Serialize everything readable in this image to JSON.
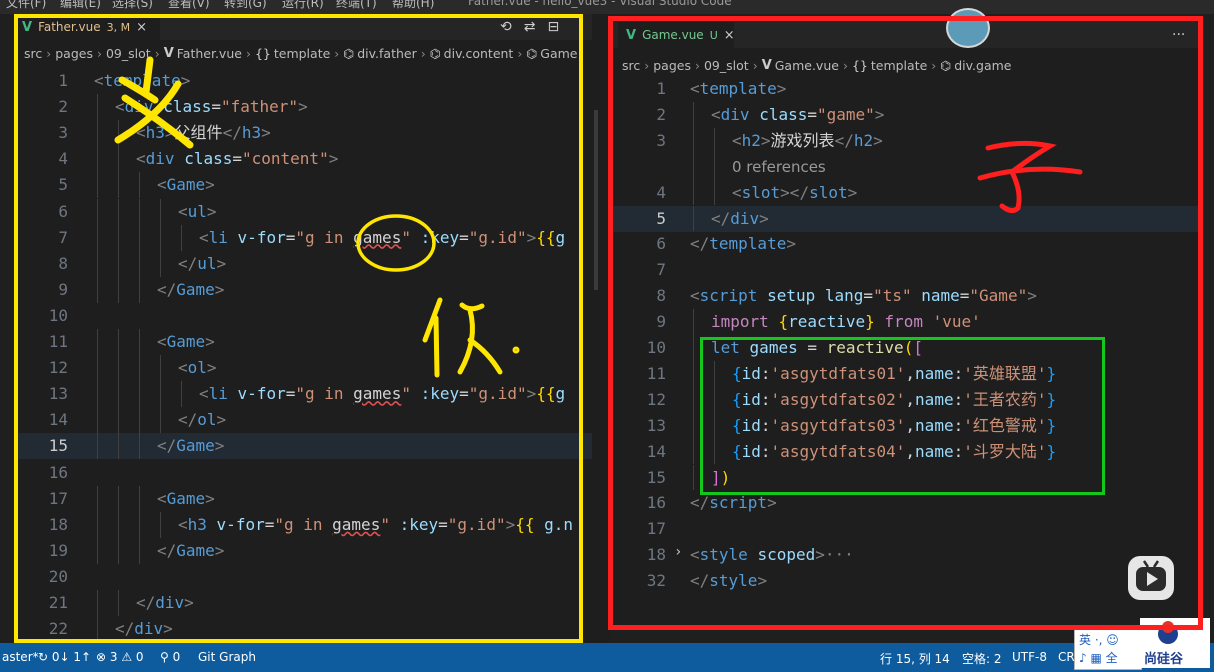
{
  "window": {
    "menu": [
      "文件(F)",
      "编辑(E)",
      "选择(S)",
      "查看(V)",
      "转到(G)",
      "运行(R)",
      "终端(T)",
      "帮助(H)"
    ],
    "title": "Father.vue - hello_vue3 - Visual Studio Code"
  },
  "left_editor": {
    "tab": {
      "name": "Father.vue",
      "status": "3, M",
      "close": "×"
    },
    "actions": [
      "⟲",
      "⇄",
      "⊟",
      "···"
    ],
    "breadcrumb": [
      {
        "label": "src",
        "icon": ""
      },
      {
        "label": "pages",
        "icon": ""
      },
      {
        "label": "09_slot",
        "icon": ""
      },
      {
        "label": "Father.vue",
        "icon": "vue-icon"
      },
      {
        "label": "template",
        "icon": "{}"
      },
      {
        "label": "div.father",
        "icon": "⌬"
      },
      {
        "label": "div.content",
        "icon": "⌬"
      },
      {
        "label": "Game",
        "icon": "⌬"
      }
    ],
    "current_line": "15",
    "lines": [
      {
        "n": "1",
        "indent": 0,
        "tokens": [
          [
            "<",
            "pun"
          ],
          [
            "template",
            "tag"
          ],
          [
            ">",
            "pun"
          ]
        ]
      },
      {
        "n": "2",
        "indent": 1,
        "tokens": [
          [
            "<",
            "pun"
          ],
          [
            "div",
            "tag"
          ],
          [
            " ",
            "def"
          ],
          [
            "class",
            "attr"
          ],
          [
            "=",
            "def"
          ],
          [
            "\"father\"",
            "str"
          ],
          [
            ">",
            "pun"
          ]
        ]
      },
      {
        "n": "3",
        "indent": 2,
        "tokens": [
          [
            "<",
            "pun"
          ],
          [
            "h3",
            "tag"
          ],
          [
            ">",
            "pun"
          ],
          [
            "父组件",
            "def"
          ],
          [
            "</",
            "pun"
          ],
          [
            "h3",
            "tag"
          ],
          [
            ">",
            "pun"
          ]
        ]
      },
      {
        "n": "4",
        "indent": 2,
        "tokens": [
          [
            "<",
            "pun"
          ],
          [
            "div",
            "tag"
          ],
          [
            " ",
            "def"
          ],
          [
            "class",
            "attr"
          ],
          [
            "=",
            "def"
          ],
          [
            "\"content\"",
            "str"
          ],
          [
            ">",
            "pun"
          ]
        ]
      },
      {
        "n": "5",
        "indent": 3,
        "tokens": [
          [
            "<",
            "pun"
          ],
          [
            "Game",
            "tag"
          ],
          [
            ">",
            "pun"
          ]
        ]
      },
      {
        "n": "6",
        "indent": 4,
        "tokens": [
          [
            "<",
            "pun"
          ],
          [
            "ul",
            "tag"
          ],
          [
            ">",
            "pun"
          ]
        ]
      },
      {
        "n": "7",
        "indent": 5,
        "tokens": [
          [
            "<",
            "pun"
          ],
          [
            "li",
            "tag"
          ],
          [
            " ",
            "def"
          ],
          [
            "v-for",
            "attr"
          ],
          [
            "=",
            "def"
          ],
          [
            "\"g in ",
            "str"
          ],
          [
            "games",
            "sq"
          ],
          [
            "\"",
            "str"
          ],
          [
            " ",
            "def"
          ],
          [
            ":key",
            "attr"
          ],
          [
            "=",
            "def"
          ],
          [
            "\"g.id\"",
            "str"
          ],
          [
            ">",
            "pun"
          ],
          [
            "{{",
            "br1"
          ],
          [
            "g",
            "var"
          ]
        ]
      },
      {
        "n": "8",
        "indent": 4,
        "tokens": [
          [
            "</",
            "pun"
          ],
          [
            "ul",
            "tag"
          ],
          [
            ">",
            "pun"
          ]
        ]
      },
      {
        "n": "9",
        "indent": 3,
        "tokens": [
          [
            "</",
            "pun"
          ],
          [
            "Game",
            "tag"
          ],
          [
            ">",
            "pun"
          ]
        ]
      },
      {
        "n": "10",
        "indent": 0,
        "tokens": []
      },
      {
        "n": "11",
        "indent": 3,
        "tokens": [
          [
            "<",
            "pun"
          ],
          [
            "Game",
            "tag"
          ],
          [
            ">",
            "pun"
          ]
        ]
      },
      {
        "n": "12",
        "indent": 4,
        "tokens": [
          [
            "<",
            "pun"
          ],
          [
            "ol",
            "tag"
          ],
          [
            ">",
            "pun"
          ]
        ]
      },
      {
        "n": "13",
        "indent": 5,
        "tokens": [
          [
            "<",
            "pun"
          ],
          [
            "li",
            "tag"
          ],
          [
            " ",
            "def"
          ],
          [
            "v-for",
            "attr"
          ],
          [
            "=",
            "def"
          ],
          [
            "\"g in ",
            "str"
          ],
          [
            "games",
            "sq"
          ],
          [
            "\"",
            "str"
          ],
          [
            " ",
            "def"
          ],
          [
            ":key",
            "attr"
          ],
          [
            "=",
            "def"
          ],
          [
            "\"g.id\"",
            "str"
          ],
          [
            ">",
            "pun"
          ],
          [
            "{{",
            "br1"
          ],
          [
            "g",
            "var"
          ]
        ]
      },
      {
        "n": "14",
        "indent": 4,
        "tokens": [
          [
            "</",
            "pun"
          ],
          [
            "ol",
            "tag"
          ],
          [
            ">",
            "pun"
          ]
        ]
      },
      {
        "n": "15",
        "indent": 3,
        "tokens": [
          [
            "</",
            "pun"
          ],
          [
            "Game",
            "tag"
          ],
          [
            ">",
            "pun"
          ]
        ]
      },
      {
        "n": "16",
        "indent": 0,
        "tokens": []
      },
      {
        "n": "17",
        "indent": 3,
        "tokens": [
          [
            "<",
            "pun"
          ],
          [
            "Game",
            "tag"
          ],
          [
            ">",
            "pun"
          ]
        ]
      },
      {
        "n": "18",
        "indent": 4,
        "tokens": [
          [
            "<",
            "pun"
          ],
          [
            "h3",
            "tag"
          ],
          [
            " ",
            "def"
          ],
          [
            "v-for",
            "attr"
          ],
          [
            "=",
            "def"
          ],
          [
            "\"g in ",
            "str"
          ],
          [
            "games",
            "sq"
          ],
          [
            "\"",
            "str"
          ],
          [
            " ",
            "def"
          ],
          [
            ":key",
            "attr"
          ],
          [
            "=",
            "def"
          ],
          [
            "\"g.id\"",
            "str"
          ],
          [
            ">",
            "pun"
          ],
          [
            "{{",
            "br1"
          ],
          [
            " g.n",
            "var"
          ]
        ]
      },
      {
        "n": "19",
        "indent": 3,
        "tokens": [
          [
            "</",
            "pun"
          ],
          [
            "Game",
            "tag"
          ],
          [
            ">",
            "pun"
          ]
        ]
      },
      {
        "n": "20",
        "indent": 0,
        "tokens": []
      },
      {
        "n": "21",
        "indent": 2,
        "tokens": [
          [
            "</",
            "pun"
          ],
          [
            "div",
            "tag"
          ],
          [
            ">",
            "pun"
          ]
        ]
      },
      {
        "n": "22",
        "indent": 1,
        "tokens": [
          [
            "</",
            "pun"
          ],
          [
            "div",
            "tag"
          ],
          [
            ">",
            "pun"
          ]
        ]
      }
    ]
  },
  "right_editor": {
    "tab": {
      "name": "Game.vue",
      "status": "U",
      "close": "×"
    },
    "actions": [
      "···"
    ],
    "breadcrumb": [
      {
        "label": "src",
        "icon": ""
      },
      {
        "label": "pages",
        "icon": ""
      },
      {
        "label": "09_slot",
        "icon": ""
      },
      {
        "label": "Game.vue",
        "icon": "vue-icon"
      },
      {
        "label": "template",
        "icon": "{}"
      },
      {
        "label": "div.game",
        "icon": "⌬"
      }
    ],
    "current_line": "5",
    "lines": [
      {
        "n": "1",
        "indent": 0,
        "tokens": [
          [
            "<",
            "pun"
          ],
          [
            "template",
            "tag"
          ],
          [
            ">",
            "pun"
          ]
        ]
      },
      {
        "n": "2",
        "indent": 1,
        "tokens": [
          [
            "<",
            "pun"
          ],
          [
            "div",
            "tag"
          ],
          [
            " ",
            "def"
          ],
          [
            "class",
            "attr"
          ],
          [
            "=",
            "def"
          ],
          [
            "\"game\"",
            "str"
          ],
          [
            ">",
            "pun"
          ]
        ]
      },
      {
        "n": "3",
        "indent": 2,
        "tokens": [
          [
            "<",
            "pun"
          ],
          [
            "h2",
            "tag"
          ],
          [
            ">",
            "pun"
          ],
          [
            "游戏列表",
            "def"
          ],
          [
            "</",
            "pun"
          ],
          [
            "h2",
            "tag"
          ],
          [
            ">",
            "pun"
          ]
        ]
      },
      {
        "n": "",
        "indent": 2,
        "tokens": [
          [
            "0 references",
            "lens"
          ]
        ]
      },
      {
        "n": "4",
        "indent": 2,
        "tokens": [
          [
            "<",
            "pun"
          ],
          [
            "slot",
            "tag"
          ],
          [
            "></",
            "pun"
          ],
          [
            "slot",
            "tag"
          ],
          [
            ">",
            "pun"
          ]
        ]
      },
      {
        "n": "5",
        "indent": 1,
        "tokens": [
          [
            "</",
            "pun"
          ],
          [
            "div",
            "tag"
          ],
          [
            ">",
            "pun"
          ]
        ]
      },
      {
        "n": "6",
        "indent": 0,
        "tokens": [
          [
            "</",
            "pun"
          ],
          [
            "template",
            "tag"
          ],
          [
            ">",
            "pun"
          ]
        ]
      },
      {
        "n": "7",
        "indent": 0,
        "tokens": []
      },
      {
        "n": "8",
        "indent": 0,
        "tokens": [
          [
            "<",
            "pun"
          ],
          [
            "script",
            "tag"
          ],
          [
            " ",
            "def"
          ],
          [
            "setup",
            "attr"
          ],
          [
            " ",
            "def"
          ],
          [
            "lang",
            "attr"
          ],
          [
            "=",
            "def"
          ],
          [
            "\"ts\"",
            "str"
          ],
          [
            " ",
            "def"
          ],
          [
            "name",
            "attr"
          ],
          [
            "=",
            "def"
          ],
          [
            "\"Game\"",
            "str"
          ],
          [
            ">",
            "pun"
          ]
        ]
      },
      {
        "n": "9",
        "indent": 1,
        "tokens": [
          [
            "import",
            "key"
          ],
          [
            " ",
            "def"
          ],
          [
            "{",
            "br1"
          ],
          [
            "reactive",
            "var"
          ],
          [
            "}",
            "br1"
          ],
          [
            " ",
            "def"
          ],
          [
            "from",
            "key"
          ],
          [
            " ",
            "def"
          ],
          [
            "'vue'",
            "str"
          ]
        ]
      },
      {
        "n": "10",
        "indent": 1,
        "tokens": [
          [
            "let",
            "kw"
          ],
          [
            " ",
            "def"
          ],
          [
            "games",
            "var"
          ],
          [
            " = ",
            "def"
          ],
          [
            "reactive",
            "fn"
          ],
          [
            "(",
            "br1"
          ],
          [
            "[",
            "br2"
          ]
        ]
      },
      {
        "n": "11",
        "indent": 2,
        "tokens": [
          [
            "{",
            "br3"
          ],
          [
            "id",
            "var"
          ],
          [
            ":",
            "def"
          ],
          [
            "'asgytdfats01'",
            "str"
          ],
          [
            ",",
            "def"
          ],
          [
            "name",
            "var"
          ],
          [
            ":",
            "def"
          ],
          [
            "'英雄联盟'",
            "str"
          ],
          [
            "}",
            "br3"
          ]
        ]
      },
      {
        "n": "12",
        "indent": 2,
        "tokens": [
          [
            "{",
            "br3"
          ],
          [
            "id",
            "var"
          ],
          [
            ":",
            "def"
          ],
          [
            "'asgytdfats02'",
            "str"
          ],
          [
            ",",
            "def"
          ],
          [
            "name",
            "var"
          ],
          [
            ":",
            "def"
          ],
          [
            "'王者农药'",
            "str"
          ],
          [
            "}",
            "br3"
          ]
        ]
      },
      {
        "n": "13",
        "indent": 2,
        "tokens": [
          [
            "{",
            "br3"
          ],
          [
            "id",
            "var"
          ],
          [
            ":",
            "def"
          ],
          [
            "'asgytdfats03'",
            "str"
          ],
          [
            ",",
            "def"
          ],
          [
            "name",
            "var"
          ],
          [
            ":",
            "def"
          ],
          [
            "'红色警戒'",
            "str"
          ],
          [
            "}",
            "br3"
          ]
        ]
      },
      {
        "n": "14",
        "indent": 2,
        "tokens": [
          [
            "{",
            "br3"
          ],
          [
            "id",
            "var"
          ],
          [
            ":",
            "def"
          ],
          [
            "'asgytdfats04'",
            "str"
          ],
          [
            ",",
            "def"
          ],
          [
            "name",
            "var"
          ],
          [
            ":",
            "def"
          ],
          [
            "'斗罗大陆'",
            "str"
          ],
          [
            "}",
            "br3"
          ]
        ]
      },
      {
        "n": "15",
        "indent": 1,
        "tokens": [
          [
            "]",
            "br2"
          ],
          [
            ")",
            "br1"
          ]
        ]
      },
      {
        "n": "16",
        "indent": 0,
        "tokens": [
          [
            "</",
            "pun"
          ],
          [
            "script",
            "tag"
          ],
          [
            ">",
            "pun"
          ]
        ]
      },
      {
        "n": "17",
        "indent": 0,
        "tokens": []
      },
      {
        "n": "18",
        "indent": 0,
        "tokens": [
          [
            "<",
            "pun"
          ],
          [
            "style",
            "tag"
          ],
          [
            " ",
            "def"
          ],
          [
            "scoped",
            "attr"
          ],
          [
            ">",
            "pun"
          ],
          [
            "···",
            "pun"
          ]
        ]
      },
      {
        "n": "32",
        "indent": 0,
        "tokens": [
          [
            "</",
            "pun"
          ],
          [
            "style",
            "tag"
          ],
          [
            ">",
            "pun"
          ]
        ]
      }
    ]
  },
  "statusbar": {
    "branch": "aster*",
    "sync": "↻ 0↓ 1↑",
    "problems": "⊗ 3 ⚠ 0",
    "ports": "⚲ 0",
    "git_graph": "Git Graph",
    "position": "行 15, 列 14",
    "spaces": "空格: 2",
    "encoding": "UTF-8",
    "eol": "CR"
  },
  "ime": {
    "line1": "英 ·, ☺",
    "line2": "♪ ▦ 全"
  },
  "watermark": {
    "brand": "尚硅谷"
  },
  "annotations": {
    "colors": {
      "yellow": "#ffe600",
      "red": "#ff1f1f",
      "green": "#13c81a"
    },
    "handwriting": {
      "left": "父",
      "left_note": "依.",
      "right": "子"
    }
  }
}
